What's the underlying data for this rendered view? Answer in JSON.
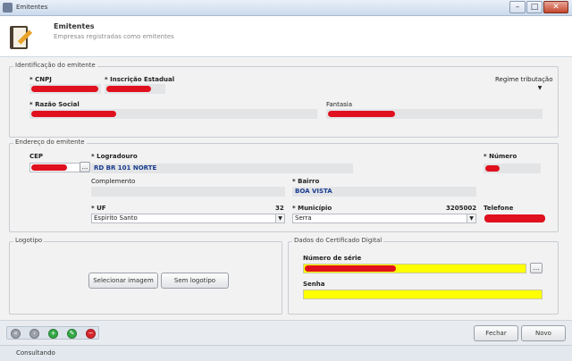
{
  "window": {
    "title": "Emitentes",
    "minimize": "–",
    "maximize": "□",
    "close": "✕"
  },
  "header": {
    "title": "Emitentes",
    "subtitle": "Empresas registradas como emitentes"
  },
  "ident": {
    "legend": "Identificação do emitente",
    "cnpj_label": "CNPJ",
    "ie_label": "Inscrição Estadual",
    "regime_label": "Regime tributação",
    "razao_label": "Razão Social",
    "fantasia_label": "Fantasia"
  },
  "endereco": {
    "legend": "Endereço do emitente",
    "cep_label": "CEP",
    "cep_button": "...",
    "logradouro_label": "Logradouro",
    "logradouro_value": "RD BR 101 NORTE",
    "numero_label": "Número",
    "complemento_label": "Complemento",
    "bairro_label": "Bairro",
    "bairro_value": "BOA VISTA",
    "uf_label": "UF",
    "uf_code": "32",
    "uf_value": "Espirito Santo",
    "municipio_label": "Município",
    "municipio_code": "3205002",
    "municipio_value": "Serra",
    "telefone_label": "Telefone"
  },
  "logotipo": {
    "legend": "Logotipo",
    "select_button": "Selecionar imagem",
    "remove_button": "Sem logotipo"
  },
  "certificado": {
    "legend": "Dados do Certificado Digital",
    "serie_label": "Número de série",
    "senha_label": "Senha",
    "lookup_button": "…"
  },
  "nav": [
    "«",
    "‹",
    "+",
    "✎",
    "−"
  ],
  "footer": {
    "cancel_button": "Fechar",
    "save_button": "Novo"
  },
  "status": {
    "text": "Consultando"
  }
}
